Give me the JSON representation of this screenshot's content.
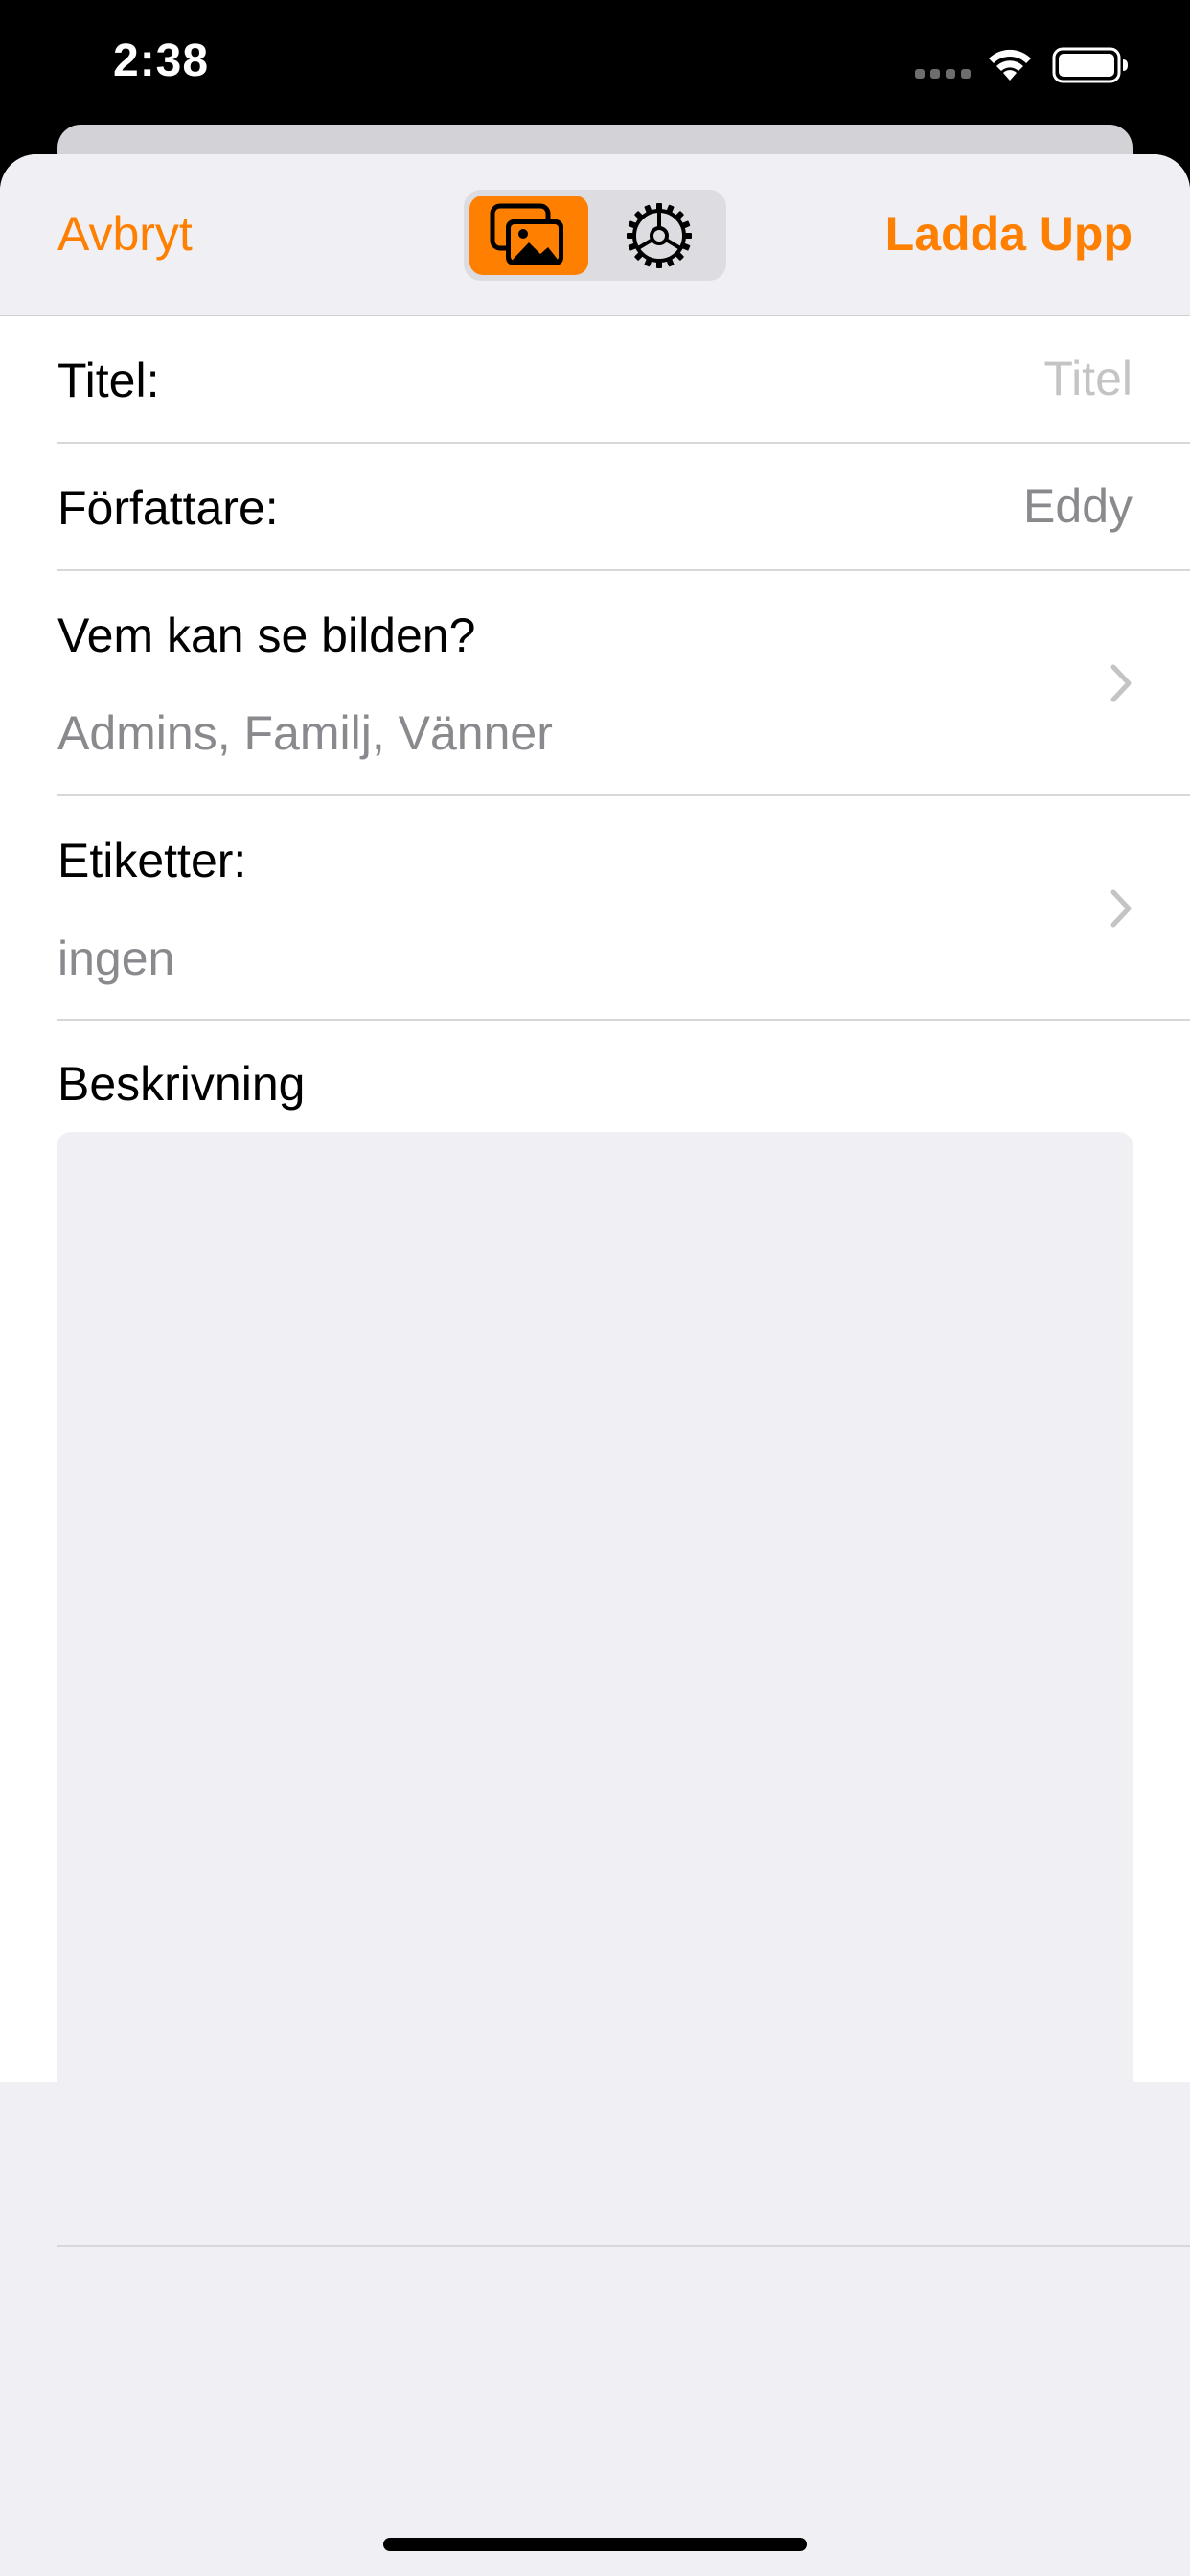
{
  "status_bar": {
    "time": "2:38",
    "wifi_icon": "wifi-icon",
    "battery_icon": "battery-icon"
  },
  "nav": {
    "cancel_label": "Avbryt",
    "upload_label": "Ladda Upp",
    "segments": [
      {
        "icon": "photos-icon",
        "selected": true
      },
      {
        "icon": "gear-icon",
        "selected": false
      }
    ],
    "accent_color": "#ff7f00"
  },
  "form": {
    "title": {
      "label": "Titel:",
      "placeholder": "Titel"
    },
    "author": {
      "label": "Författare:",
      "value": "Eddy"
    },
    "privacy": {
      "label": "Vem kan se bilden?",
      "value": "Admins, Familj, Vänner"
    },
    "tags": {
      "label": "Etiketter:",
      "value": "ingen"
    },
    "description": {
      "label": "Beskrivning",
      "value": ""
    }
  }
}
